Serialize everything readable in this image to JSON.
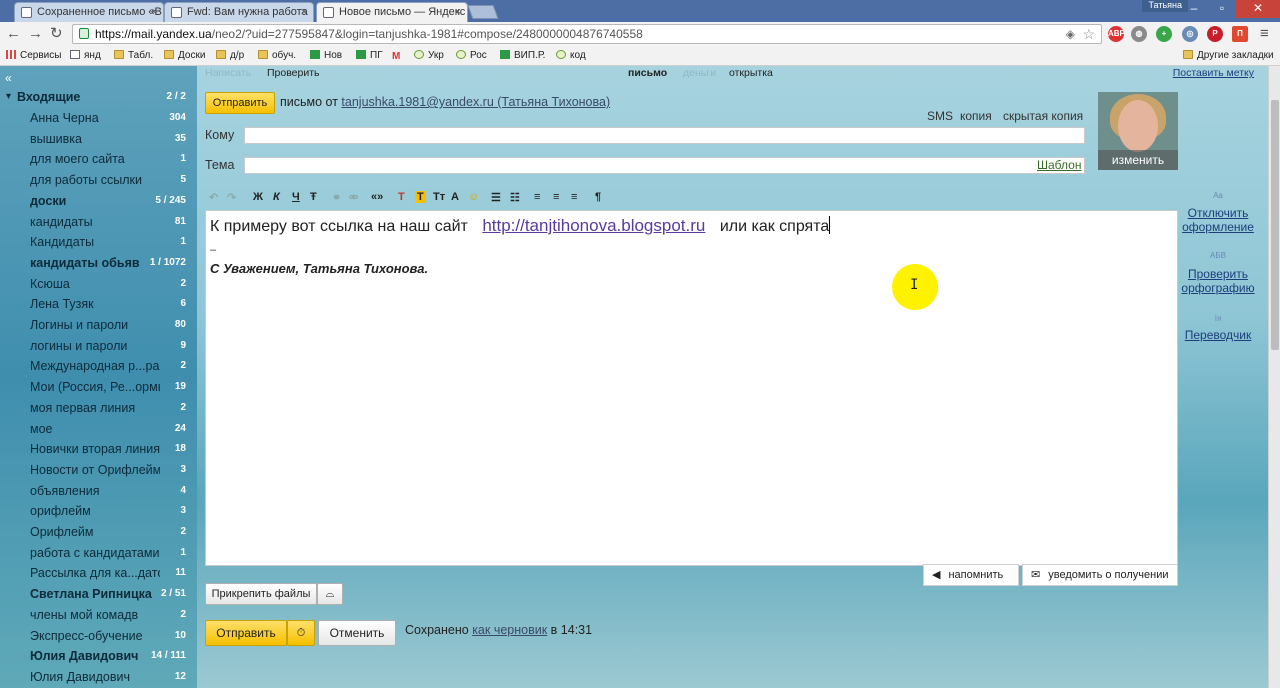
{
  "browser": {
    "tabs": [
      {
        "title": "Сохраненное письмо «В"
      },
      {
        "title": "Fwd: Вам нужна работа"
      },
      {
        "title": "Новое письмо — Яндекс"
      }
    ],
    "user": "Татьяна",
    "url_host": "https://mail.yandex.ua",
    "url_path": "/neo2/?uid=277595847&login=tanjushka-1981#compose/2480000004876740558",
    "bookmarks": [
      "Сервисы",
      "янд",
      "Табл.",
      "Доски",
      "д/р",
      "обуч.",
      "Нов",
      "ПГ",
      "Укр",
      "Рос",
      "ВИП.Р.",
      "код"
    ],
    "other_bookmarks": "Другие закладки"
  },
  "sidebar": {
    "collapse": "«",
    "inbox": {
      "label": "Входящие",
      "count": "2 / 2"
    },
    "folders": [
      {
        "label": "Анна Черна",
        "count": "304"
      },
      {
        "label": "вышивка",
        "count": "35"
      },
      {
        "label": "для моего сайта",
        "count": "1"
      },
      {
        "label": "для работы ссылки",
        "count": "5"
      },
      {
        "label": "доски",
        "count": "5 / 245",
        "bold": true
      },
      {
        "label": "кандидаты",
        "count": "81"
      },
      {
        "label": "Кандидаты",
        "count": "1"
      },
      {
        "label": "кандидаты обьяв",
        "count": "1 / 1072",
        "bold": true
      },
      {
        "label": "Ксюша",
        "count": "2"
      },
      {
        "label": "Лена Тузяк",
        "count": "6"
      },
      {
        "label": "Логины и пароли",
        "count": "80"
      },
      {
        "label": "логины и пароли",
        "count": "9"
      },
      {
        "label": "Международная р...раци",
        "count": "2"
      },
      {
        "label": "Мои (Россия, Ре...ормь",
        "count": "19"
      },
      {
        "label": "моя первая линия",
        "count": "2"
      },
      {
        "label": "мое",
        "count": "24"
      },
      {
        "label": "Новички вторая линия",
        "count": "18"
      },
      {
        "label": "Новости от Орифлейм",
        "count": "3"
      },
      {
        "label": "объявления",
        "count": "4"
      },
      {
        "label": "орифлейм",
        "count": "3"
      },
      {
        "label": "Орифлейм",
        "count": "2"
      },
      {
        "label": "работа с кандидатами",
        "count": "1"
      },
      {
        "label": "Рассылка для ка...дато",
        "count": "11"
      },
      {
        "label": "Светлана Рипницка",
        "count": "2 / 51",
        "bold": true
      },
      {
        "label": "члены мой комадв",
        "count": "2"
      },
      {
        "label": "Экспресс-обучение",
        "count": "10"
      },
      {
        "label": "Юлия Давидович",
        "count": "14 / 111",
        "bold": true
      },
      {
        "label": "Юлия Давидович",
        "count": "12"
      }
    ]
  },
  "compose": {
    "mode": {
      "write": "Написать",
      "check": "Проверить",
      "letter": "письмо",
      "money": "деньги",
      "postcard": "открытка"
    },
    "set_label": "Поставить метку",
    "send_label": "Отправить",
    "from_prefix": "письмо от",
    "from_address": "tanjushka.1981@yandex.ru (Татьяна Тихонова)",
    "sms": "SMS",
    "cc": "копия",
    "bcc": "скрытая копия",
    "to_label": "Кому",
    "to_value": "",
    "subject_label": "Тема",
    "subject_value": "",
    "template_link": "Шаблон",
    "avatar_change": "изменить",
    "toolbar": {
      "bold": "Ж",
      "italic": "К",
      "underline": "Ч",
      "strike": "Ŧ",
      "quote": "«»",
      "textcolor": "T",
      "bgcolor": "T",
      "fontsize": "Tт"
    },
    "body_text": "К примеру вот ссылка на наш сайт",
    "body_link": "http://tanjtihonova.blogspot.ru",
    "body_tail": "или как спрята",
    "signature_dash": "–",
    "signature": "С Уважением, Татьяна Тихонова.",
    "right_tools": {
      "disable_format": "Отключить оформление",
      "spellcheck": "Проверить орфографию",
      "translator": "Переводчик"
    },
    "remind": "напомнить",
    "notify_receipt": "уведомить о получении",
    "attach": "Прикрепить файлы",
    "send_bottom": "Отправить",
    "cancel": "Отменить",
    "saved_prefix": "Сохранено",
    "saved_link": "как черновик",
    "saved_time": "в 14:31"
  }
}
